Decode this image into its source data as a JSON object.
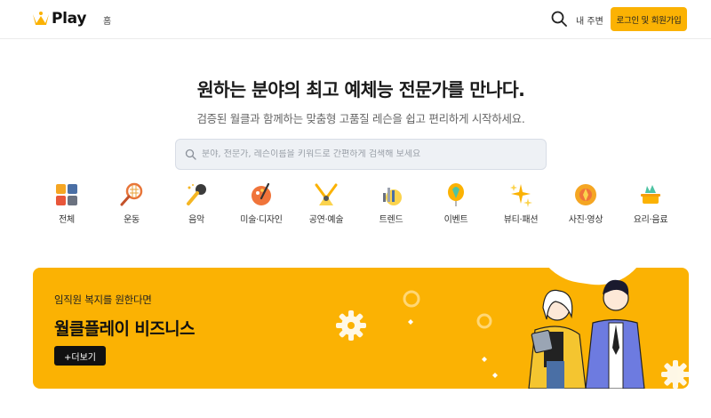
{
  "header": {
    "logo_text": "Play",
    "nav_home": "홈",
    "my_area": "내 주변",
    "login_label": "로그인 및 회원가입"
  },
  "hero": {
    "title": "원하는 분야의 최고 예체능 전문가를 만나다.",
    "subtitle": "검증된 월클과 함께하는 맞춤형 고품질 레슨을 쉽고 편리하게 시작하세요.",
    "search_placeholder": "분야, 전문가, 레슨이름을 키워드로 간편하게 검색해 보세요"
  },
  "categories": [
    {
      "label": "전체",
      "icon": "grid-icon"
    },
    {
      "label": "운동",
      "icon": "racket-icon"
    },
    {
      "label": "음악",
      "icon": "microphone-icon"
    },
    {
      "label": "미술·디자인",
      "icon": "palette-icon"
    },
    {
      "label": "공연·예술",
      "icon": "spotlight-icon"
    },
    {
      "label": "트렌드",
      "icon": "trend-chart-icon"
    },
    {
      "label": "이벤트",
      "icon": "balloon-icon"
    },
    {
      "label": "뷰티·패션",
      "icon": "sparkle-icon"
    },
    {
      "label": "사진·영상",
      "icon": "camera-lens-icon"
    },
    {
      "label": "요리·음료",
      "icon": "cooking-icon"
    }
  ],
  "banner": {
    "subtitle": "임직원 복지를 원한다면",
    "title": "월클플레이 비즈니스",
    "more_label": "+더보기"
  },
  "colors": {
    "accent": "#fbb203",
    "text": "#1a1a1a",
    "search_bg": "#eef1f5"
  }
}
